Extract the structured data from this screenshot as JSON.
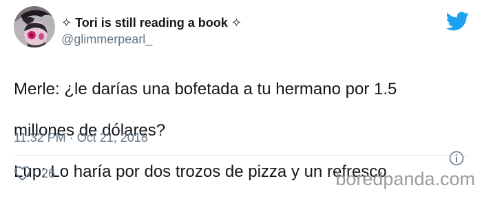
{
  "author": {
    "display_name": "✧ Tori is still reading a book ✧",
    "handle": "@glimmerpearl_",
    "avatar_icon": "avatar-illustration"
  },
  "tweet": {
    "text_lines": [
      "Merle: ¿le darías una bofetada a tu hermano por 1.5",
      "millones de dólares?",
      "Lup: Lo haría por dos trozos de pizza y un refresco"
    ],
    "timestamp": "11:32 PM · Oct 21, 2018",
    "likes": "26"
  },
  "icons": {
    "brand": "twitter-bird-icon",
    "info": "info-icon",
    "like": "heart-icon"
  },
  "watermark": "boredpanda.com",
  "colors": {
    "twitter_blue": "#1da1f2",
    "text": "#14171a",
    "secondary": "#657786",
    "divider": "#e1e8ed",
    "watermark": "#9b9b9b"
  }
}
